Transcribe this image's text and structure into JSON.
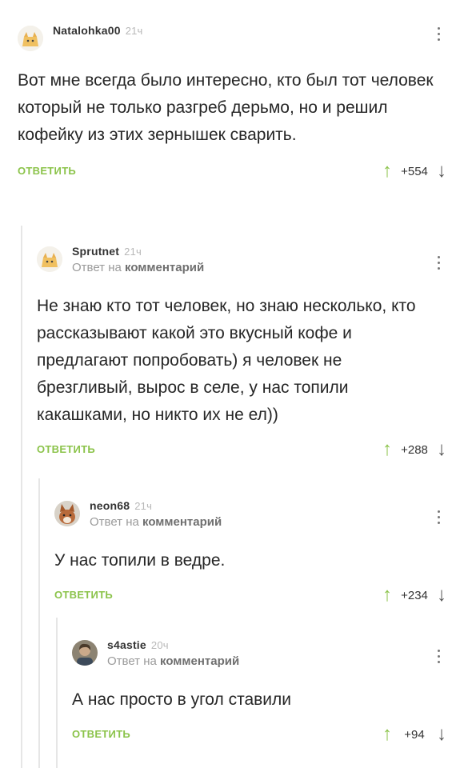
{
  "comments": [
    {
      "username": "Natalohka00",
      "time": "21ч",
      "avatar": "cat-avatar-icon",
      "text": "Вот мне всегда было интересно, кто был тот человек который не только разгреб дерьмо, но и решил кофейку из этих зернышек сварить.",
      "reply_label": "ОТВЕТИТЬ",
      "score": "+554"
    },
    {
      "username": "Sprutnet",
      "time": "21ч",
      "avatar": "cat-avatar-icon",
      "reply_prefix": "Ответ на",
      "reply_link": "комментарий",
      "text": "Не знаю кто тот человек, но знаю несколько, кто рассказывают какой это вкусный кофе и предлагают попробовать) я человек не брезгливый, вырос в селе, у нас топили какашками, но никто их не ел))",
      "reply_label": "ОТВЕТИТЬ",
      "score": "+288"
    },
    {
      "username": "neon68",
      "time": "21ч",
      "avatar": "fox-avatar-icon",
      "reply_prefix": "Ответ на",
      "reply_link": "комментарий",
      "text": "У нас топили в ведре.",
      "reply_label": "ОТВЕТИТЬ",
      "score": "+234"
    },
    {
      "username": "s4astie",
      "time": "20ч",
      "avatar": "photo-avatar-icon",
      "reply_prefix": "Ответ на",
      "reply_link": "комментарий",
      "text": "А нас просто в угол ставили",
      "reply_label": "ОТВЕТИТЬ",
      "score": "+94"
    }
  ],
  "icons": {
    "upvote": "arrow-up-icon",
    "downvote": "arrow-down-icon",
    "menu": "more-vertical-icon"
  },
  "colors": {
    "accent": "#8bc34a",
    "text": "#262626",
    "muted": "#9a9a9a"
  }
}
